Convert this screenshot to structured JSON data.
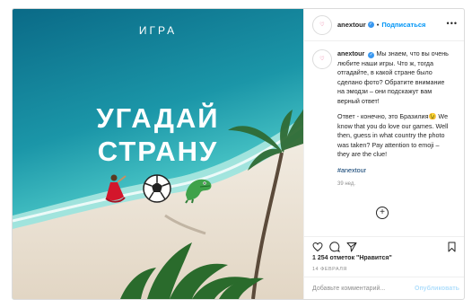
{
  "photo": {
    "game_label": "ИГРА",
    "headline_line1": "УГАДАЙ",
    "headline_line2": "СТРАНУ",
    "emojis": [
      "flamenco-dancer",
      "soccer-ball",
      "crocodile"
    ]
  },
  "header": {
    "username": "anextour",
    "separator": "•",
    "follow_label": "Подписаться",
    "more_label": "•••"
  },
  "caption": {
    "username": "anextour",
    "text_ru": "Мы знаем, что вы очень любите наши игры. Что ж, тогда отгадайте, в какой стране было сделано фото? Обратите внимание на эмодзи – они подскажут вам верный ответ!",
    "answer": "Ответ - конечно, это Бразилия😉 We know that you do love our games. Well then, guess in what country the photo was taken? Pay attention to emoji – they are the clue!",
    "hashtag": "#anextour",
    "time_ago": "39 нед."
  },
  "footer": {
    "likes": "1 254 отметок \"Нравится\"",
    "date": "14 ФЕВРАЛЯ",
    "comment_placeholder": "Добавьте комментарий...",
    "publish_label": "Опубликовать"
  },
  "colors": {
    "link": "#0095f6",
    "verified": "#3897f0",
    "muted": "#8e8e8e"
  }
}
